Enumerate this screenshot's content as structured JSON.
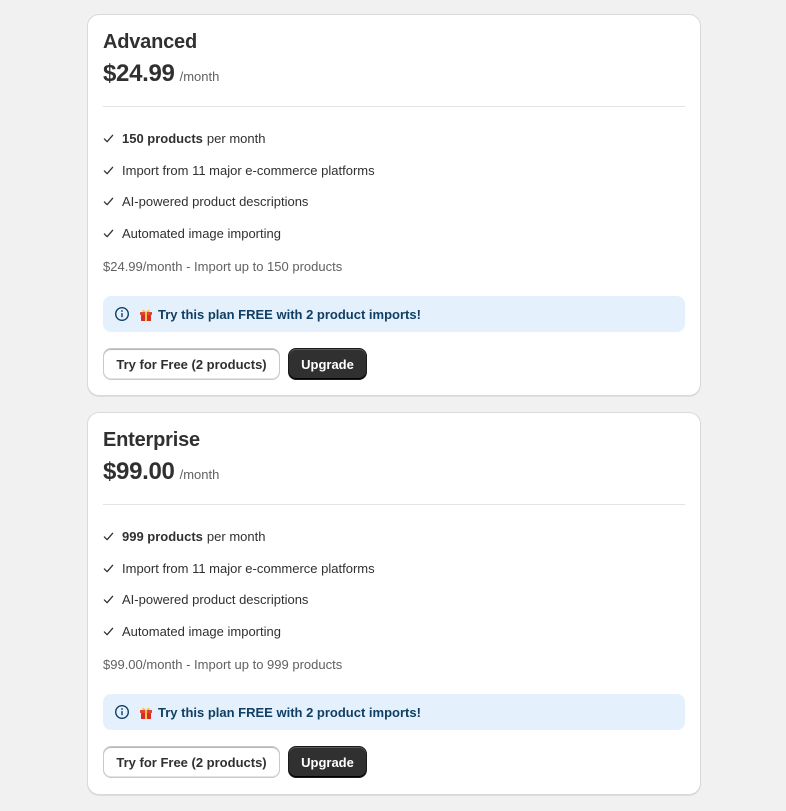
{
  "colors": {
    "page_background": "#f1f1f1",
    "card_background": "#ffffff",
    "banner_background": "#e4f1fd",
    "banner_text": "#103f63",
    "primary_button": "#303030",
    "check_color": "#303030"
  },
  "plans": [
    {
      "name": "Advanced",
      "price": "$24.99",
      "period": "/month",
      "features": [
        {
          "bold": "150 products",
          "text": "per month",
          "icon": "check-icon"
        },
        {
          "bold": "",
          "text": "Import from 11 major e-commerce platforms",
          "icon": "check-icon"
        },
        {
          "bold": "",
          "text": "AI-powered product descriptions",
          "icon": "check-icon"
        },
        {
          "bold": "",
          "text": "Automated image importing",
          "icon": "check-icon"
        }
      ],
      "summary": "$24.99/month - Import up to 150 products",
      "banner": {
        "text": "Try this plan FREE with 2 product imports!",
        "icons": [
          "info-icon",
          "gift-icon"
        ]
      },
      "try_button": "Try for Free (2 products)",
      "upgrade_button": "Upgrade"
    },
    {
      "name": "Enterprise",
      "price": "$99.00",
      "period": "/month",
      "features": [
        {
          "bold": "999 products",
          "text": "per month",
          "icon": "check-icon"
        },
        {
          "bold": "",
          "text": "Import from 11 major e-commerce platforms",
          "icon": "check-icon"
        },
        {
          "bold": "",
          "text": "AI-powered product descriptions",
          "icon": "check-icon"
        },
        {
          "bold": "",
          "text": "Automated image importing",
          "icon": "check-icon"
        }
      ],
      "summary": "$99.00/month - Import up to 999 products",
      "banner": {
        "text": "Try this plan FREE with 2 product imports!",
        "icons": [
          "info-icon",
          "gift-icon"
        ]
      },
      "try_button": "Try for Free (2 products)",
      "upgrade_button": "Upgrade"
    }
  ]
}
